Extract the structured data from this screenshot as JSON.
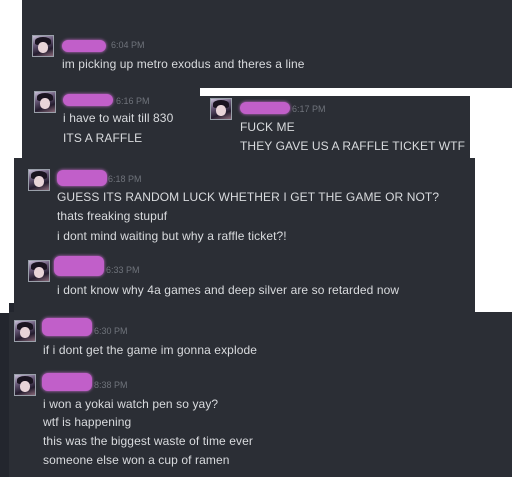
{
  "messages": [
    {
      "time": "6:04 PM",
      "lines": [
        "im picking up metro exodus and theres a line"
      ]
    },
    {
      "time": "6:16 PM",
      "lines": [
        "i have to wait till 830",
        "ITS A RAFFLE"
      ]
    },
    {
      "time": "6:17 PM",
      "lines": [
        "FUCK ME",
        "THEY GAVE US A RAFFLE TICKET WTF"
      ]
    },
    {
      "time": "6:18 PM",
      "lines": [
        "GUESS ITS RANDOM LUCK WHETHER I GET THE GAME OR NOT?",
        "thats freaking stupuf",
        "i dont mind waiting but why a raffle ticket?!"
      ]
    },
    {
      "time": "6:33 PM",
      "lines": [
        "i dont know why 4a games and deep silver are so retarded now"
      ]
    },
    {
      "time": "6:30 PM",
      "lines": [
        "if i dont get the game im gonna explode"
      ]
    },
    {
      "time": "8:38 PM",
      "lines": [
        "i won a yokai watch pen so yay?",
        "wtf is happening",
        "this was the biggest waste of time ever",
        "someone else won a cup of ramen"
      ]
    }
  ]
}
